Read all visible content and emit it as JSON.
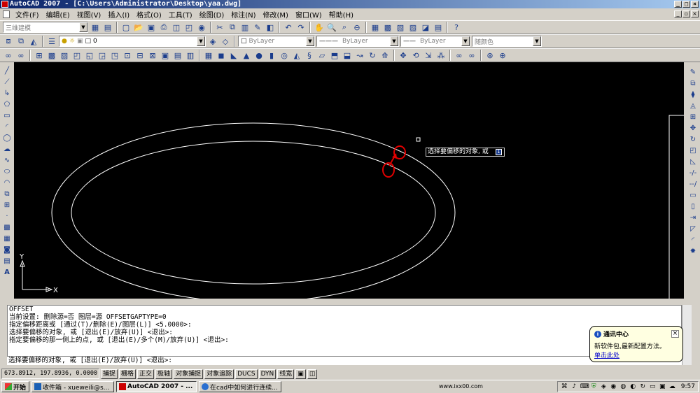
{
  "window": {
    "title": "AutoCAD 2007 - [C:\\Users\\Administrator\\Desktop\\yaa.dwg]"
  },
  "menu": [
    "文件(F)",
    "编辑(E)",
    "视图(V)",
    "插入(I)",
    "格式(O)",
    "工具(T)",
    "绘图(D)",
    "标注(N)",
    "修改(M)",
    "窗口(W)",
    "帮助(H)"
  ],
  "toolbar": {
    "workspace": "三维建模",
    "layer_value": "0",
    "color": "ByLayer",
    "linetype": "ByLayer",
    "lineweight": "ByLayer",
    "plotstyle": "随颜色"
  },
  "canvas": {
    "axis_y": "Y",
    "axis_x": "X",
    "tooltip": "选择要偏移的对象, 或"
  },
  "command": {
    "history": [
      "OFFSET",
      "当前设置: 删除源=否  图层=源  OFFSETGAPTYPE=0",
      "指定偏移距离或 [通过(T)/删除(E)/图层(L)] <5.0000>:",
      "选择要偏移的对象, 或 [退出(E)/放弃(U)] <退出>:",
      "指定要偏移的那一侧上的点, 或 [退出(E)/多个(M)/放弃(U)] <退出>:"
    ],
    "prompt": "选择要偏移的对象, 或 [退出(E)/放弃(U)] <退出>:"
  },
  "status": {
    "coords": "673.8912, 197.8936, 0.0000",
    "buttons": [
      "捕捉",
      "栅格",
      "正交",
      "极轴",
      "对象捕捉",
      "对象追踪",
      "DUCS",
      "DYN",
      "线宽"
    ]
  },
  "balloon": {
    "title": "通讯中心",
    "message": "新软件包,最新配置方法。",
    "link": "单击此处"
  },
  "taskbar": {
    "start": "开始",
    "tasks": [
      "收件箱 - xueweili@s...",
      "AutoCAD 2007 - ...",
      "在cad中如何进行连续..."
    ],
    "url_text": "www.ixx00.com",
    "clock": "9:57"
  },
  "colors": {
    "titlebar_start": "#0a246a",
    "canvas_bg": "#000000",
    "geometry": "#ffffff",
    "marker": "#e00000"
  }
}
